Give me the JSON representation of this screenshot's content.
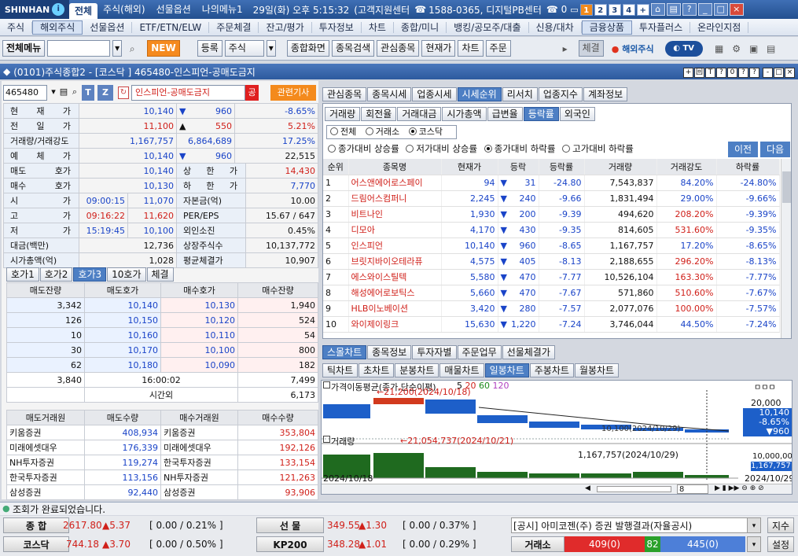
{
  "app": {
    "brand": "SHINHAN",
    "active_tab": "전체",
    "tabs": [
      "주식(해외)",
      "선물옵션",
      "나의메뉴1"
    ],
    "datetime": "29일(화) 오후 5:15:32",
    "cs": "(고객지원센터",
    "phone": "1588-0365, 디지털PB센터",
    "page_nums": [
      "1",
      "2",
      "3",
      "4"
    ]
  },
  "menu": [
    "주식",
    "해외주식",
    "선물옵션",
    "ETF/ETN/ELW",
    "주문체결",
    "잔고/평가",
    "투자정보",
    "차트",
    "종합/미니",
    "뱅킹/공모주/대출",
    "신용/대차",
    "금융상품",
    "투자플러스",
    "온라인지점"
  ],
  "toolbar": {
    "menu_btn": "전체메뉴",
    "new": "NEW",
    "reg": "등록",
    "stock": "주식",
    "btns": [
      "종합화면",
      "종목검색",
      "관심종목",
      "현재가",
      "차트",
      "주문"
    ],
    "chegyeol": "체결",
    "overseas": "해외주식"
  },
  "panel": {
    "title": "(0101)주식종합2 - [코스닥 ] 465480-인스피언-공매도금지",
    "btns": [
      "+",
      "回",
      "T",
      "?",
      "0",
      "?",
      "?",
      "-",
      "□",
      "×"
    ]
  },
  "quote": {
    "code": "465480",
    "name": "인스피언-공매도금지",
    "gong": "공",
    "news": "관련기사",
    "rows": [
      {
        "l": "현 재 가",
        "v1": "10,140",
        "arr": "▼",
        "v2": "960",
        "v3": "-8.65%",
        "c": "blue"
      },
      {
        "l": "전 일 가",
        "v1": "11,100",
        "arr": "▲",
        "v2": "550",
        "v3": "5.21%",
        "c": "red"
      },
      {
        "l": "거래량/거래강도",
        "v1": "1,167,757",
        "arr": "",
        "v2": "6,864,689",
        "v3": "17.25%",
        "c": "blue"
      },
      {
        "l": "예 체 가",
        "v1": "10,140",
        "arr": "▼",
        "v2": "960",
        "v3": "22,515",
        "c": "blue"
      }
    ],
    "grid": [
      {
        "l": "매도 호가",
        "v": "10,140",
        "l2": "상 한 가",
        "v2": "14,430",
        "c2": "red"
      },
      {
        "l": "매수 호가",
        "v": "10,130",
        "l2": "하 한 가",
        "v2": "7,770",
        "c2": "blue"
      },
      {
        "l": "시 가",
        "t": "09:00:15",
        "v": "11,070",
        "l2": "자본금(억)",
        "v2": "10.00"
      },
      {
        "l": "고 가",
        "t": "09:16:22",
        "v": "11,620",
        "l2": "PER/EPS",
        "v2": "15.67 / 647"
      },
      {
        "l": "저 가",
        "t": "15:19:45",
        "v": "10,100",
        "l2": "외인소진",
        "v2": "0.45%"
      },
      {
        "l": "대금(백만)",
        "v": "12,736",
        "l2": "상장주식수",
        "v2": "10,137,772"
      },
      {
        "l": "시가총액(억)",
        "v": "1,028",
        "l2": "평균체결가",
        "v2": "10,907"
      }
    ]
  },
  "hoga": {
    "tabs": [
      "호가1",
      "호가2",
      "호가3",
      "10호가",
      "체결"
    ],
    "headers": [
      "매도잔량",
      "매도호가",
      "매수호가",
      "매수잔량"
    ],
    "rows": [
      [
        "3,342",
        "10,140",
        "10,130",
        "1,940"
      ],
      [
        "126",
        "10,150",
        "10,120",
        "524"
      ],
      [
        "10",
        "10,160",
        "10,110",
        "54"
      ],
      [
        "30",
        "10,170",
        "10,100",
        "800"
      ],
      [
        "62",
        "10,180",
        "10,090",
        "182"
      ]
    ],
    "total_ask": "3,840",
    "time": "16:00:02",
    "total_bid": "7,499",
    "after_label": "시간외",
    "after": "6,173",
    "broker_headers": [
      "매도거래원",
      "매도수량",
      "매수거래원",
      "매수수량"
    ],
    "brokers": [
      [
        "키움증권",
        "408,934",
        "키움증권",
        "353,804"
      ],
      [
        "미래에셋대우",
        "176,339",
        "미래에셋대우",
        "192,126"
      ],
      [
        "NH투자증권",
        "119,274",
        "한국투자증권",
        "133,154"
      ],
      [
        "한국투자증권",
        "113,156",
        "NH투자증권",
        "121,263"
      ],
      [
        "삼성증권",
        "92,440",
        "삼성증권",
        "93,906"
      ]
    ]
  },
  "rtabs1": [
    "관심종목",
    "종목시세",
    "업종시세",
    "시세순위",
    "리서치",
    "업종지수",
    "계좌정보"
  ],
  "rtabs2": [
    "거래량",
    "회전율",
    "거래대금",
    "시가총액",
    "급변율",
    "등락률",
    "외국인"
  ],
  "market_radio": [
    "전체",
    "거래소",
    "코스닥"
  ],
  "cond_radio": [
    "종가대비 상승률",
    "저가대비 상승률",
    "종가대비 하락률",
    "고가대비 하락률"
  ],
  "nav": {
    "prev": "이전",
    "next": "다음"
  },
  "rank_headers": [
    "순위",
    "종목명",
    "현재가",
    "등락",
    "등락률",
    "거래량",
    "거래강도",
    "하락률"
  ],
  "ranks": [
    [
      "1",
      "어스앤에어로스페이",
      "94",
      "31",
      "-24.80",
      "7,543,837",
      "84.20%",
      "-24.80%"
    ],
    [
      "2",
      "드림어스컴퍼니",
      "2,245",
      "240",
      "-9.66",
      "1,831,494",
      "29.00%",
      "-9.66%"
    ],
    [
      "3",
      "비트나인",
      "1,930",
      "200",
      "-9.39",
      "494,620",
      "208.20%",
      "-9.39%"
    ],
    [
      "4",
      "디모아",
      "4,170",
      "430",
      "-9.35",
      "814,605",
      "531.60%",
      "-9.35%"
    ],
    [
      "5",
      "인스피언",
      "10,140",
      "960",
      "-8.65",
      "1,167,757",
      "17.20%",
      "-8.65%"
    ],
    [
      "6",
      "브릿지바이오테라퓨",
      "4,575",
      "405",
      "-8.13",
      "2,188,655",
      "296.20%",
      "-8.13%"
    ],
    [
      "7",
      "에스와이스틸텍",
      "5,580",
      "470",
      "-7.77",
      "10,526,104",
      "163.30%",
      "-7.77%"
    ],
    [
      "8",
      "해성에어로보틱스",
      "5,660",
      "470",
      "-7.67",
      "571,860",
      "510.60%",
      "-7.67%"
    ],
    [
      "9",
      "HLB이노베이션",
      "3,420",
      "280",
      "-7.57",
      "2,077,076",
      "100.00%",
      "-7.57%"
    ],
    [
      "10",
      "와이제이링크",
      "15,630",
      "1,220",
      "-7.24",
      "3,746,044",
      "44.50%",
      "-7.24%"
    ]
  ],
  "ctabs1": [
    "스몰차트",
    "종목정보",
    "투자자별",
    "주문업무",
    "선물체결가"
  ],
  "ctabs2": [
    "틱차트",
    "초차트",
    "분봉차트",
    "매물차트",
    "일봉차트",
    "주봉차트",
    "월봉차트"
  ],
  "chart": {
    "ma_title": "가격이동평균(종가,단순이평)",
    "ma": [
      "5",
      "20",
      "60",
      "120"
    ],
    "high_ann": "21,200(2024/10/18)",
    "y1": "20,000",
    "cur": "10,140",
    "cur_pct": "-8.65%",
    "cur_chg": "▼960",
    "low_ann": "10,100(2024/10/29)",
    "vol_title": "거래량",
    "vol_ann1": "21,054,737(2024/10/21)",
    "vol_ann2": "1,167,757(2024/10/29)",
    "vol_y": "10,000,00",
    "vol_cur": "1,167,757",
    "x1": "2024/10/18",
    "x2": "2024/10/29",
    "zoom": "8"
  },
  "status": "조회가 완료되었습니다.",
  "ticker": [
    {
      "name": "종 합",
      "val": "2617.80",
      "chg": "▲5.37",
      "pct": "[ 0.00 / 0.21% ]",
      "name2": "선 물",
      "val2": "349.55",
      "chg2": "▲1.30",
      "pct2": "[ 0.00 / 0.37% ]"
    },
    {
      "name": "코스닥",
      "val": "744.18",
      "chg": "▲3.70",
      "pct": "[ 0.00 / 0.50% ]",
      "name2": "KP200",
      "val2": "348.28",
      "chg2": "▲1.01",
      "pct2": "[ 0.00 / 0.29% ]"
    }
  ],
  "notice": "[공시] 아미코젠(주) 증권 발행결과(자율공시)",
  "jisu": "지수",
  "exchange": "거래소",
  "ex_sell": "409(0)",
  "ex_mid": "82",
  "ex_buy": "445(0)",
  "setting": "설정"
}
